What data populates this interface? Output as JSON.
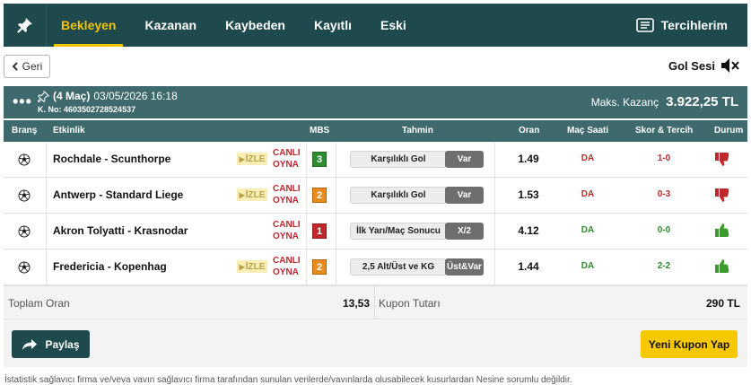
{
  "nav": {
    "tabs": [
      {
        "label": "Bekleyen",
        "active": true
      },
      {
        "label": "Kazanan",
        "active": false
      },
      {
        "label": "Kaybeden",
        "active": false
      },
      {
        "label": "Kayıtlı",
        "active": false
      },
      {
        "label": "Eski",
        "active": false
      }
    ],
    "preferences_label": "Tercihlerim",
    "active_color": "#f2c200",
    "bg_color": "#1e4a4d"
  },
  "toolbar": {
    "back_label": "Geri",
    "gol_sesi_label": "Gol Sesi"
  },
  "coupon": {
    "match_count": "(4 Maç)",
    "datetime": "03/05/2026 16:18",
    "kupon_no": "K. No: 4603502728524537",
    "max_win_label": "Maks. Kazanç",
    "max_win_value": "3.922,25 TL"
  },
  "table": {
    "headers": {
      "brans": "Branş",
      "etkinlik": "Etkinlik",
      "mbs": "MBS",
      "tahmin": "Tahmin",
      "oran": "Oran",
      "mac_saati": "Maç Saati",
      "skor": "Skor & Tercih",
      "durum": "Durum"
    },
    "rows": [
      {
        "event": "Rochdale - Scunthorpe",
        "izle": "İZLE",
        "canli1": "CANLI",
        "canli2": "OYNA",
        "mbs": "3",
        "mbs_color": "#2e8b2e",
        "tahmin": "Karşılıklı Gol",
        "tercih": "Var",
        "oran": "1.49",
        "mac_saati": "DA",
        "mac_color": "#c0272d",
        "skor": "1-0",
        "skor_color": "#c0272d",
        "durum": "lost"
      },
      {
        "event": "Antwerp - Standard Liege",
        "izle": "İZLE",
        "canli1": "CANLI",
        "canli2": "OYNA",
        "mbs": "2",
        "mbs_color": "#e98a1d",
        "tahmin": "Karşılıklı Gol",
        "tercih": "Var",
        "oran": "1.53",
        "mac_saati": "DA",
        "mac_color": "#c0272d",
        "skor": "0-3",
        "skor_color": "#c0272d",
        "durum": "lost"
      },
      {
        "event": "Akron Tolyatti - Krasnodar",
        "izle": "",
        "canli1": "CANLI",
        "canli2": "OYNA",
        "mbs": "1",
        "mbs_color": "#c0272d",
        "tahmin": "İlk Yarı/Maç Sonucu",
        "tercih": "X/2",
        "oran": "4.12",
        "mac_saati": "DA",
        "mac_color": "#2e8b2e",
        "skor": "0-0",
        "skor_color": "#2e8b2e",
        "durum": "won"
      },
      {
        "event": "Fredericia - Kopenhag",
        "izle": "İZLE",
        "canli1": "CANLI",
        "canli2": "OYNA",
        "mbs": "2",
        "mbs_color": "#e98a1d",
        "tahmin": "2,5 Alt/Üst ve KG",
        "tercih": "Üst&Var",
        "oran": "1.44",
        "mac_saati": "DA",
        "mac_color": "#2e8b2e",
        "skor": "2-2",
        "skor_color": "#2e8b2e",
        "durum": "won"
      }
    ]
  },
  "totals": {
    "toplam_oran_label": "Toplam Oran",
    "toplam_oran_value": "13,53",
    "kupon_tutari_label": "Kupon Tutarı",
    "kupon_tutari_value": "290 TL"
  },
  "actions": {
    "paylas_label": "Paylaş",
    "yeni_kupon_label": "Yeni Kupon Yap"
  },
  "disclaimer": "İstatistik sağlavıcı firma ve/veva vavın sağlavıcı firma tarafından sunulan verilerde/vavınlarda olusabilecek kusurlardan Nesine sorumlu değildir."
}
